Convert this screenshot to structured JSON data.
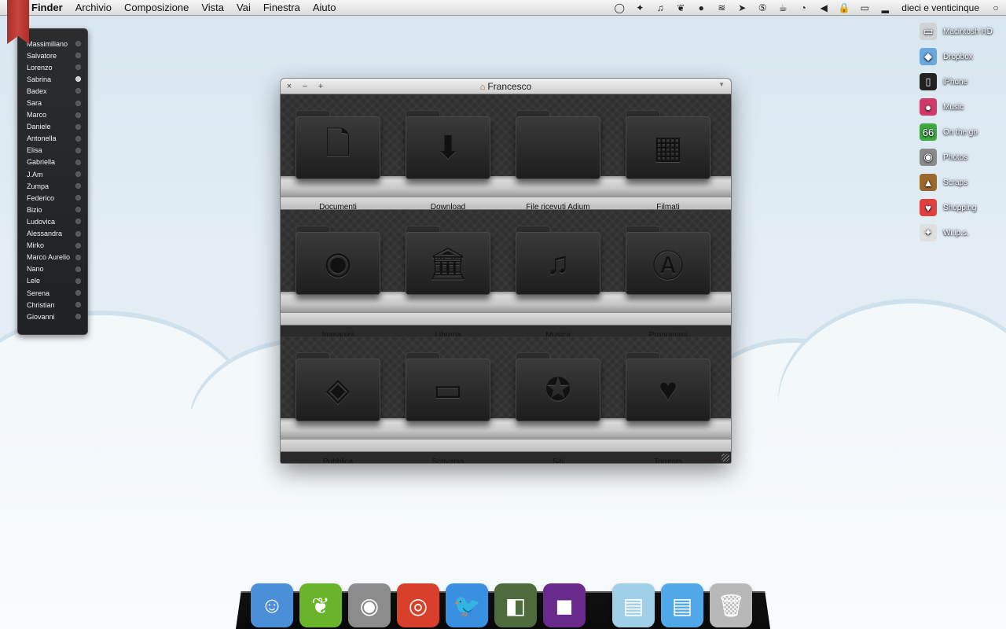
{
  "menubar": {
    "app_name": "Finder",
    "menus": [
      "Archivio",
      "Composizione",
      "Vista",
      "Vai",
      "Finestra",
      "Aiuto"
    ],
    "clock": "dieci e venticinque",
    "status_icons": [
      "speech-bubble-icon",
      "paw-icon",
      "music-note-icon",
      "leaf-icon",
      "bowler-hat-icon",
      "satellite-icon",
      "cursor-icon",
      "badge-5-icon",
      "coffee-cup-icon",
      "timer-icon",
      "volume-icon",
      "lock-icon",
      "battery-icon",
      "signal-bars-icon",
      "spotlight-icon"
    ]
  },
  "contacts": [
    {
      "name": "Massimiliano",
      "online": false
    },
    {
      "name": "Salvatore",
      "online": false
    },
    {
      "name": "Lorenzo",
      "online": false
    },
    {
      "name": "Sabrina",
      "online": true
    },
    {
      "name": "Badex",
      "online": false
    },
    {
      "name": "Sara",
      "online": false
    },
    {
      "name": "Marco",
      "online": false
    },
    {
      "name": "Daniele",
      "online": false
    },
    {
      "name": "Antonella",
      "online": false
    },
    {
      "name": "Elisa",
      "online": false
    },
    {
      "name": "Gabriella",
      "online": false
    },
    {
      "name": "J.Am",
      "online": false
    },
    {
      "name": "Zumpa",
      "online": false
    },
    {
      "name": "Federico",
      "online": false
    },
    {
      "name": "Bizio",
      "online": false
    },
    {
      "name": "Ludovica",
      "online": false
    },
    {
      "name": "Alessandra",
      "online": false
    },
    {
      "name": "Mirko",
      "online": false
    },
    {
      "name": "Marco Aurelio",
      "online": false
    },
    {
      "name": "Nano",
      "online": false
    },
    {
      "name": "Lele",
      "online": false
    },
    {
      "name": "Serena",
      "online": false
    },
    {
      "name": "Christian",
      "online": false
    },
    {
      "name": "Giovanni",
      "online": false
    }
  ],
  "desktop_items": [
    {
      "label": "Macintosh HD",
      "icon": "hard-drive-icon",
      "glyph": "▭",
      "color": "#cfd3d6"
    },
    {
      "label": "Dropbox",
      "icon": "dropbox-icon",
      "glyph": "◆",
      "color": "#6aa8e0"
    },
    {
      "label": "iPhone",
      "icon": "iphone-icon",
      "glyph": "▯",
      "color": "#222222"
    },
    {
      "label": "Music",
      "icon": "vinyl-record-icon",
      "glyph": "●",
      "color": "#d03a6a"
    },
    {
      "label": "On the go",
      "icon": "road-sign-icon",
      "glyph": "66",
      "color": "#3caa3c"
    },
    {
      "label": "Photos",
      "icon": "camera-icon",
      "glyph": "◉",
      "color": "#8a8a8a"
    },
    {
      "label": "Scraps",
      "icon": "pile-icon",
      "glyph": "▲",
      "color": "#9b6a2a"
    },
    {
      "label": "Shopping",
      "icon": "heart-icon",
      "glyph": "♥",
      "color": "#e04040"
    },
    {
      "label": "Wi.ip.s.",
      "icon": "magic-wand-icon",
      "glyph": "✦",
      "color": "#e0e0e0"
    }
  ],
  "window": {
    "title": "Francesco",
    "buttons": {
      "close": "×",
      "minimize": "−",
      "zoom": "+"
    },
    "folders": [
      {
        "label": "Documenti",
        "icon": "document-icon",
        "glyph": "🗋"
      },
      {
        "label": "Download",
        "icon": "download-icon",
        "glyph": "⬇"
      },
      {
        "label": "File ricevuti Adium",
        "icon": "blank-folder-icon",
        "glyph": ""
      },
      {
        "label": "Filmati",
        "icon": "film-strip-icon",
        "glyph": "▦"
      },
      {
        "label": "Immagini",
        "icon": "camera-icon",
        "glyph": "◉"
      },
      {
        "label": "Libreria",
        "icon": "library-building-icon",
        "glyph": "🏛"
      },
      {
        "label": "Musica",
        "icon": "music-note-icon",
        "glyph": "♫"
      },
      {
        "label": "Programmi",
        "icon": "app-store-icon",
        "glyph": "Ⓐ"
      },
      {
        "label": "Pubblica",
        "icon": "pedestrian-sign-icon",
        "glyph": "◈"
      },
      {
        "label": "Scrivania",
        "icon": "desktop-window-icon",
        "glyph": "▭"
      },
      {
        "label": "Siti",
        "icon": "compass-icon",
        "glyph": "✪"
      },
      {
        "label": "Torrents",
        "icon": "heart-icon",
        "glyph": "♥"
      }
    ]
  },
  "dock": [
    {
      "name": "finder",
      "icon": "finder-face-icon",
      "glyph": "☺",
      "color": "#4a8fd8",
      "running": true
    },
    {
      "name": "peapod",
      "icon": "peapod-icon",
      "glyph": "❦",
      "color": "#6ab42c",
      "running": true
    },
    {
      "name": "camera",
      "icon": "camera-icon",
      "glyph": "◉",
      "color": "#8c8c8c",
      "running": false
    },
    {
      "name": "chrome",
      "icon": "chrome-icon",
      "glyph": "◎",
      "color": "#d8402c",
      "running": true
    },
    {
      "name": "twitter",
      "icon": "twitter-bird-icon",
      "glyph": "🐦",
      "color": "#3a90e0",
      "running": true
    },
    {
      "name": "adium",
      "icon": "duck-assente-icon",
      "glyph": "◧",
      "color": "#4d6b3c",
      "running": true
    },
    {
      "name": "game",
      "icon": "game-icon",
      "glyph": "◼",
      "color": "#6a2a8c",
      "running": true
    },
    {
      "name": "apps-stack",
      "icon": "apps-stack-icon",
      "glyph": "▤",
      "color": "#a0d0e8",
      "running": false
    },
    {
      "name": "downloads-stack",
      "icon": "downloads-stack-icon",
      "glyph": "▤",
      "color": "#50a8e8",
      "running": false
    },
    {
      "name": "trash",
      "icon": "trash-icon",
      "glyph": "🗑",
      "color": "#b8b8b8",
      "running": false
    }
  ]
}
